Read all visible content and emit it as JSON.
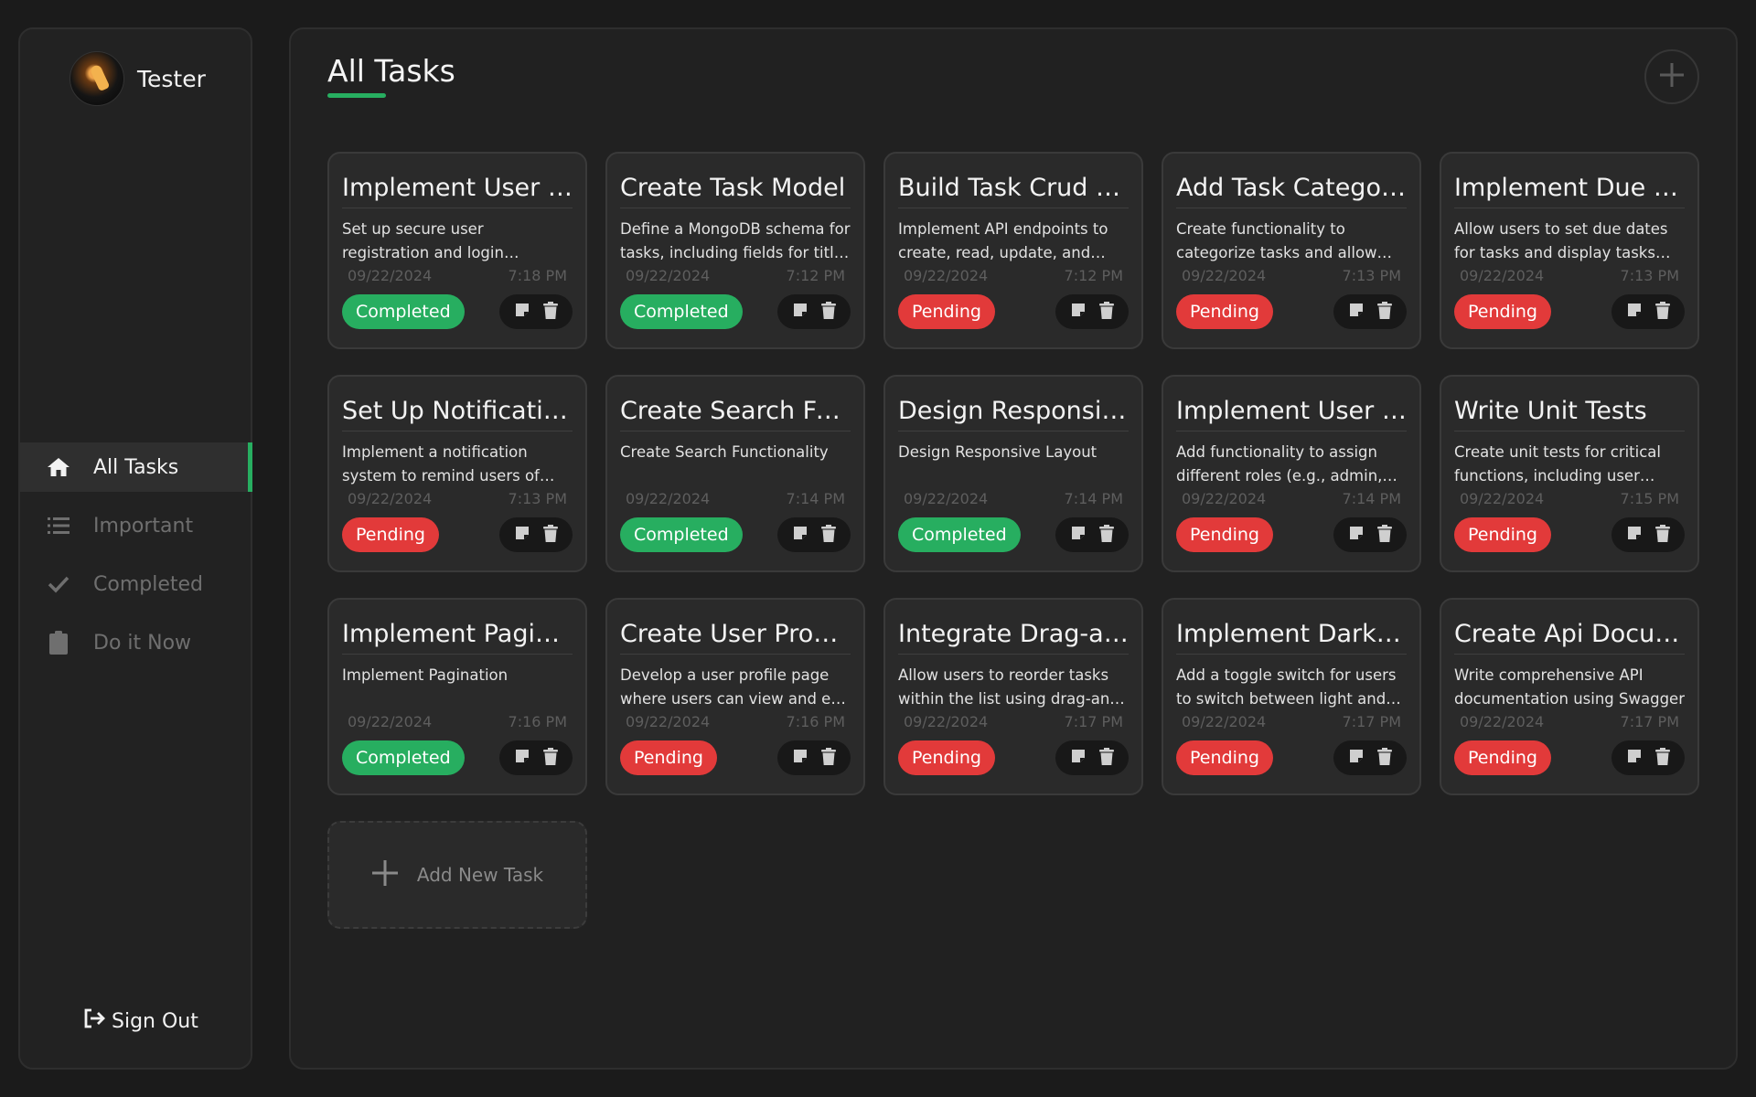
{
  "user": {
    "name": "Tester"
  },
  "sidebar": {
    "items": [
      {
        "label": "All Tasks",
        "icon": "home-icon",
        "active": true
      },
      {
        "label": "Important",
        "icon": "list-icon",
        "active": false
      },
      {
        "label": "Completed",
        "icon": "check-icon",
        "active": false
      },
      {
        "label": "Do it Now",
        "icon": "clipboard-icon",
        "active": false
      }
    ],
    "signout_label": "Sign Out"
  },
  "main": {
    "title": "All Tasks",
    "add_new_label": "Add New Task"
  },
  "colors": {
    "accent": "#27ae60",
    "pending": "#e23a3a",
    "completed": "#27ae60"
  },
  "tasks": [
    {
      "title": "Implement User Authentication",
      "desc": "Set up secure user registration and login functionality using JWT",
      "date": "09/22/2024",
      "time": "7:18 PM",
      "status": "Completed"
    },
    {
      "title": "Create Task Model",
      "desc": "Define a MongoDB schema for tasks, including fields for title, description",
      "date": "09/22/2024",
      "time": "7:12 PM",
      "status": "Completed"
    },
    {
      "title": "Build Task Crud Operations",
      "desc": "Implement API endpoints to create, read, update, and delete tasks",
      "date": "09/22/2024",
      "time": "7:12 PM",
      "status": "Pending"
    },
    {
      "title": "Add Task Categories",
      "desc": "Create functionality to categorize tasks and allow filtering",
      "date": "09/22/2024",
      "time": "7:13 PM",
      "status": "Pending"
    },
    {
      "title": "Implement Due Dates",
      "desc": "Allow users to set due dates for tasks and display tasks sorted",
      "date": "09/22/2024",
      "time": "7:13 PM",
      "status": "Pending"
    },
    {
      "title": "Set Up Notifications",
      "desc": "Implement a notification system to remind users of upcoming tasks",
      "date": "09/22/2024",
      "time": "7:13 PM",
      "status": "Pending"
    },
    {
      "title": "Create Search Functionality",
      "desc": "Create Search Functionality",
      "date": "09/22/2024",
      "time": "7:14 PM",
      "status": "Completed"
    },
    {
      "title": "Design Responsive Layout",
      "desc": "Design Responsive Layout",
      "date": "09/22/2024",
      "time": "7:14 PM",
      "status": "Completed"
    },
    {
      "title": "Implement User Roles",
      "desc": "Add functionality to assign different roles (e.g., admin, user)",
      "date": "09/22/2024",
      "time": "7:14 PM",
      "status": "Pending"
    },
    {
      "title": "Write Unit Tests",
      "desc": "Create unit tests for critical functions, including user authentication",
      "date": "09/22/2024",
      "time": "7:15 PM",
      "status": "Pending"
    },
    {
      "title": "Implement Pagination",
      "desc": "Implement Pagination",
      "date": "09/22/2024",
      "time": "7:16 PM",
      "status": "Completed"
    },
    {
      "title": "Create User Profile Page",
      "desc": "Develop a user profile page where users can view and edit their details",
      "date": "09/22/2024",
      "time": "7:16 PM",
      "status": "Pending"
    },
    {
      "title": "Integrate Drag-and-Drop",
      "desc": "Allow users to reorder tasks within the list using drag-and-drop",
      "date": "09/22/2024",
      "time": "7:17 PM",
      "status": "Pending"
    },
    {
      "title": "Implement Dark Mode",
      "desc": "Add a toggle switch for users to switch between light and dark themes",
      "date": "09/22/2024",
      "time": "7:17 PM",
      "status": "Pending"
    },
    {
      "title": "Create Api Documentation",
      "desc": "Write comprehensive API documentation using Swagger",
      "date": "09/22/2024",
      "time": "7:17 PM",
      "status": "Pending"
    }
  ]
}
